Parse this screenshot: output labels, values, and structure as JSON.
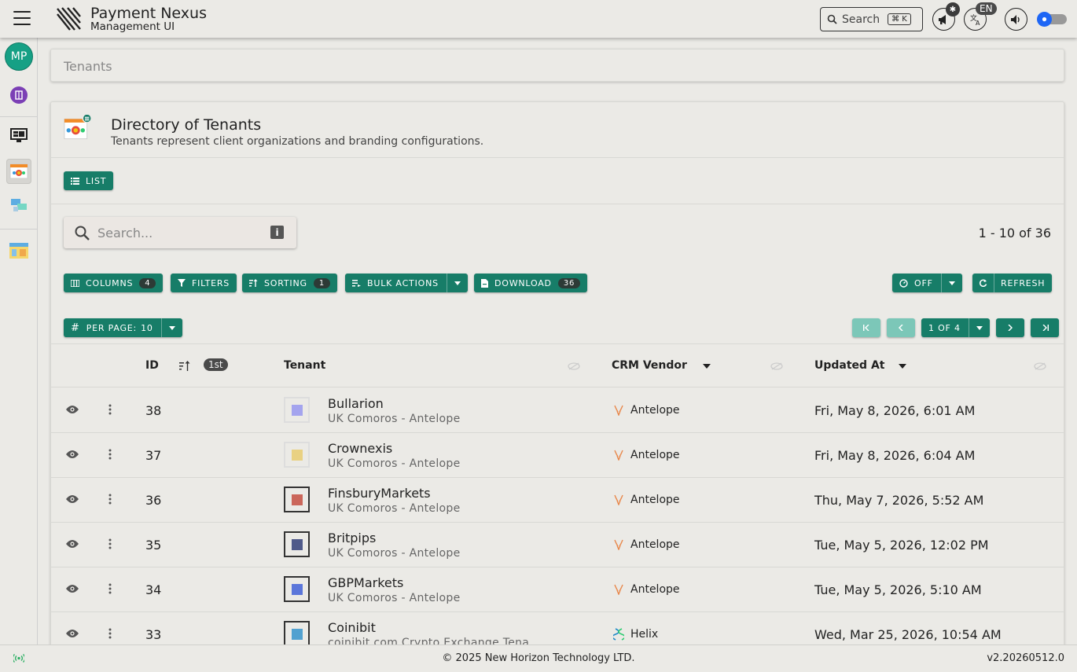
{
  "app": {
    "title": "Payment Nexus",
    "subtitle": "Management UI"
  },
  "topbar": {
    "search_label": "Search",
    "search_shortcut": "⌘ K",
    "language": "EN"
  },
  "sidebar": {
    "avatar_initials": "MP"
  },
  "breadcrumb": {
    "current": "Tenants"
  },
  "page": {
    "title": "Directory of Tenants",
    "description": "Tenants represent client organizations and branding configurations."
  },
  "view_mode": {
    "list_label": "LIST"
  },
  "search": {
    "placeholder": "Search..."
  },
  "results": {
    "range": "1 - 10 of 36"
  },
  "toolbar": {
    "columns_label": "COLUMNS",
    "columns_count": "4",
    "filters_label": "FILTERS",
    "sorting_label": "SORTING",
    "sorting_count": "1",
    "bulk_label": "BULK ACTIONS",
    "download_label": "DOWNLOAD",
    "download_count": "36",
    "auto_refresh_label": "OFF",
    "refresh_label": "REFRESH",
    "per_page_label": "PER PAGE:",
    "per_page_value": "10",
    "page_label": "1 OF 4"
  },
  "table": {
    "headers": {
      "id": "ID",
      "order_chip": "1st",
      "tenant": "Tenant",
      "crm": "CRM Vendor",
      "updated": "Updated At"
    },
    "rows": [
      {
        "id": "38",
        "name": "Bullarion",
        "sub": "UK Comoros - Antelope",
        "vendor": "Antelope",
        "updated": "Fri, May 8, 2026, 6:01 AM",
        "logo_color": "#8c8cf0"
      },
      {
        "id": "37",
        "name": "Crownexis",
        "sub": "UK Comoros - Antelope",
        "vendor": "Antelope",
        "updated": "Fri, May 8, 2026, 6:04 AM",
        "logo_color": "#e8c860"
      },
      {
        "id": "36",
        "name": "FinsburyMarkets",
        "sub": "UK Comoros - Antelope",
        "vendor": "Antelope",
        "updated": "Thu, May 7, 2026, 5:52 AM",
        "logo_color": "#c0392b"
      },
      {
        "id": "35",
        "name": "Britpips",
        "sub": "UK Comoros - Antelope",
        "vendor": "Antelope",
        "updated": "Tue, May 5, 2026, 12:02 PM",
        "logo_color": "#1b2a6b"
      },
      {
        "id": "34",
        "name": "GBPMarkets",
        "sub": "UK Comoros - Antelope",
        "vendor": "Antelope",
        "updated": "Tue, May 5, 2026, 5:10 AM",
        "logo_color": "#2b4fd6"
      },
      {
        "id": "33",
        "name": "Coinibit",
        "sub": "coinibit.com Crypto Exchange Tena",
        "vendor": "Helix",
        "updated": "Wed, Mar 25, 2026, 10:54 AM",
        "logo_color": "#1e88c8"
      }
    ]
  },
  "footer": {
    "copyright": "© 2025 New Horizon Technology LTD.",
    "version": "v2.20260512.0"
  },
  "colors": {
    "accent": "#177d68",
    "background": "#ebeae6"
  }
}
